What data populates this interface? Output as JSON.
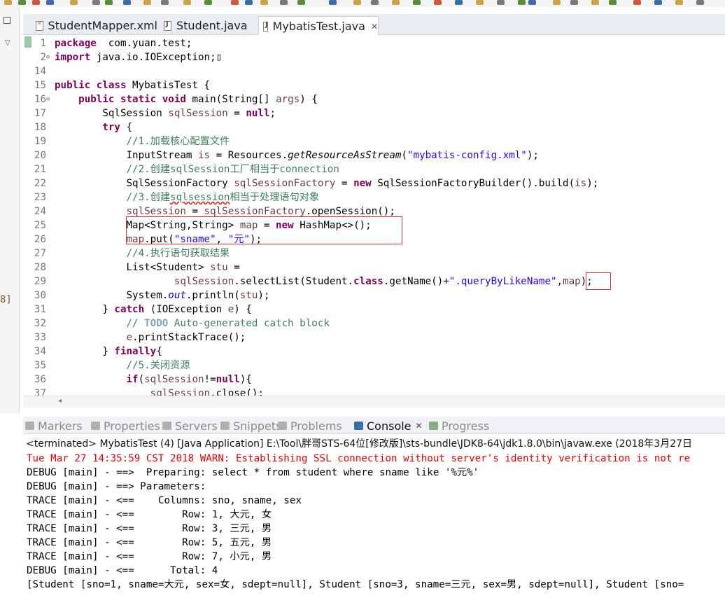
{
  "editor_tabs": [
    {
      "label": "StudentMapper.xml",
      "type": "xml"
    },
    {
      "label": "Student.java",
      "type": "java"
    },
    {
      "label": "MybatisTest.java",
      "type": "java",
      "active": true
    }
  ],
  "left_panel_fragment": "8]",
  "code_lines": [
    {
      "n": "1",
      "tokens": [
        [
          "kw",
          "package"
        ],
        [
          "",
          "  com.yuan.test;"
        ]
      ]
    },
    {
      "n": "2",
      "fold": "⊕",
      "tokens": [
        [
          "kw",
          "import"
        ],
        [
          "",
          " java.io.IOException;"
        ],
        [
          "",
          "▯"
        ]
      ]
    },
    {
      "n": "14",
      "tokens": []
    },
    {
      "n": "15",
      "tokens": [
        [
          "kw",
          "public"
        ],
        [
          "",
          " "
        ],
        [
          "kw",
          "class"
        ],
        [
          "",
          " MybatisTest {"
        ]
      ]
    },
    {
      "n": "16",
      "fold": "⊖",
      "tokens": [
        [
          "",
          "    "
        ],
        [
          "kw",
          "public"
        ],
        [
          "",
          " "
        ],
        [
          "kw",
          "static"
        ],
        [
          "",
          " "
        ],
        [
          "kw",
          "void"
        ],
        [
          "",
          " main(String[] "
        ],
        [
          "lv",
          "args"
        ],
        [
          "",
          ") {"
        ]
      ]
    },
    {
      "n": "17",
      "tokens": [
        [
          "",
          "        SqlSession "
        ],
        [
          "lv",
          "sqlSession"
        ],
        [
          "",
          " = "
        ],
        [
          "kw",
          "null"
        ],
        [
          "",
          ";"
        ]
      ]
    },
    {
      "n": "18",
      "tokens": [
        [
          "",
          "        "
        ],
        [
          "kw",
          "try"
        ],
        [
          "",
          " {"
        ]
      ]
    },
    {
      "n": "19",
      "tokens": [
        [
          "",
          "            "
        ],
        [
          "com",
          "//1.加载核心配置文件"
        ]
      ]
    },
    {
      "n": "20",
      "tokens": [
        [
          "",
          "            InputStream "
        ],
        [
          "lv",
          "is"
        ],
        [
          "",
          " = Resources."
        ],
        [
          "it",
          "getResourceAsStream"
        ],
        [
          "",
          "("
        ],
        [
          "str",
          "\"mybatis-config.xml\""
        ],
        [
          "",
          ");"
        ]
      ]
    },
    {
      "n": "21",
      "tokens": [
        [
          "",
          "            "
        ],
        [
          "com",
          "//2.创建sqlSession工厂相当于connection"
        ]
      ]
    },
    {
      "n": "22",
      "tokens": [
        [
          "",
          "            SqlSessionFactory "
        ],
        [
          "lv",
          "sqlSessionFactory"
        ],
        [
          "",
          " = "
        ],
        [
          "kw",
          "new"
        ],
        [
          "",
          " SqlSessionFactoryBuilder().build("
        ],
        [
          "lv",
          "is"
        ],
        [
          "",
          ");"
        ]
      ]
    },
    {
      "n": "23",
      "tokens": [
        [
          "",
          "            "
        ],
        [
          "com",
          "//3.创建"
        ],
        [
          "comsq",
          "sqlsession"
        ],
        [
          "com",
          "相当于处理语句对象"
        ]
      ]
    },
    {
      "n": "24",
      "tokens": [
        [
          "",
          "            "
        ],
        [
          "lv",
          "sqlSession"
        ],
        [
          "",
          " = "
        ],
        [
          "lv",
          "sqlSessionFactory"
        ],
        [
          "",
          ".openSession();"
        ]
      ]
    },
    {
      "n": "25",
      "tokens": [
        [
          "",
          "            Map<String,String> "
        ],
        [
          "lv",
          "map"
        ],
        [
          "",
          " = "
        ],
        [
          "kw",
          "new"
        ],
        [
          "",
          " HashMap<>();"
        ]
      ]
    },
    {
      "n": "26",
      "tokens": [
        [
          "",
          "            "
        ],
        [
          "lv",
          "map"
        ],
        [
          "",
          ".put("
        ],
        [
          "str",
          "\"sname\""
        ],
        [
          "",
          ", "
        ],
        [
          "str",
          "\"元\""
        ],
        [
          "",
          ");"
        ]
      ]
    },
    {
      "n": "27",
      "tokens": [
        [
          "",
          "            "
        ],
        [
          "com",
          "//4.执行语句获取结果"
        ]
      ]
    },
    {
      "n": "28",
      "tokens": [
        [
          "",
          "            List<Student> "
        ],
        [
          "lv",
          "stu"
        ],
        [
          "",
          " ="
        ]
      ]
    },
    {
      "n": "29",
      "tokens": [
        [
          "",
          "                    "
        ],
        [
          "lv",
          "sqlSession"
        ],
        [
          "",
          ".selectList(Student."
        ],
        [
          "kw",
          "class"
        ],
        [
          "",
          ".getName()+"
        ],
        [
          "str",
          "\".queryByLikeName\""
        ],
        [
          "",
          ","
        ],
        [
          "lv",
          "map"
        ],
        [
          "",
          ");"
        ]
      ]
    },
    {
      "n": "30",
      "tokens": [
        [
          "",
          "            System."
        ],
        [
          "fldit",
          "out"
        ],
        [
          "",
          ".println("
        ],
        [
          "lv",
          "stu"
        ],
        [
          "",
          ");"
        ]
      ]
    },
    {
      "n": "31",
      "tokens": [
        [
          "",
          "        } "
        ],
        [
          "kw",
          "catch"
        ],
        [
          "",
          " (IOException "
        ],
        [
          "lv",
          "e"
        ],
        [
          "",
          ") {"
        ]
      ]
    },
    {
      "n": "32",
      "tokens": [
        [
          "",
          "            "
        ],
        [
          "com",
          "// "
        ],
        [
          "todo",
          "TODO"
        ],
        [
          "com",
          " Auto-generated catch block"
        ]
      ]
    },
    {
      "n": "33",
      "tokens": [
        [
          "",
          "            "
        ],
        [
          "lv",
          "e"
        ],
        [
          "",
          ".printStackTrace();"
        ]
      ]
    },
    {
      "n": "34",
      "tokens": [
        [
          "",
          "        } "
        ],
        [
          "kw",
          "finally"
        ],
        [
          "",
          "{"
        ]
      ]
    },
    {
      "n": "35",
      "tokens": [
        [
          "",
          "            "
        ],
        [
          "com",
          "//5.关闭资源"
        ]
      ]
    },
    {
      "n": "36",
      "tokens": [
        [
          "",
          "            "
        ],
        [
          "kw",
          "if"
        ],
        [
          "",
          "("
        ],
        [
          "lv",
          "sqlSession"
        ],
        [
          "",
          "!="
        ],
        [
          "kw",
          "null"
        ],
        [
          "",
          "){"
        ]
      ]
    },
    {
      "n": "37",
      "tokens": [
        [
          "",
          "                "
        ],
        [
          "lv",
          "sqlSession"
        ],
        [
          "",
          ".close();"
        ]
      ]
    }
  ],
  "view_tabs": [
    {
      "label": "Markers",
      "color": "#b0b0b0"
    },
    {
      "label": "Properties",
      "color": "#b0b0b0"
    },
    {
      "label": "Servers",
      "color": "#b0b0b0"
    },
    {
      "label": "Snippets",
      "color": "#b0b0b0"
    },
    {
      "label": "Problems",
      "color": "#b0b0b0"
    },
    {
      "label": "Console",
      "color": "#3a6ea5",
      "active": true
    },
    {
      "label": "Progress",
      "color": "#7fb07f"
    }
  ],
  "console": {
    "header": "<terminated> MybatisTest (4) [Java Application] E:\\Tool\\胖哥STS-64位[修改版]\\sts-bundle\\JDK8-64\\jdk1.8.0\\bin\\javaw.exe (2018年3月27日",
    "lines": [
      {
        "text": "Tue Mar 27 14:35:59 CST 2018 WARN: Establishing SSL connection without server's identity verification is not re",
        "error": true
      },
      {
        "text": "DEBUG [main] - ==>  Preparing: select * from student where sname like '%元%'"
      },
      {
        "text": "DEBUG [main] - ==> Parameters: "
      },
      {
        "text": "TRACE [main] - <==    Columns: sno, sname, sex"
      },
      {
        "text": "TRACE [main] - <==        Row: 1, 大元, 女"
      },
      {
        "text": "TRACE [main] - <==        Row: 3, 三元, 男"
      },
      {
        "text": "TRACE [main] - <==        Row: 5, 五元, 男"
      },
      {
        "text": "TRACE [main] - <==        Row: 7, 小元, 男"
      },
      {
        "text": "DEBUG [main] - <==      Total: 4"
      },
      {
        "text": "[Student [sno=1, sname=大元, sex=女, sdept=null], Student [sno=3, sname=三元, sex=男, sdept=null], Student [sno="
      }
    ]
  },
  "colors": {
    "keyword": "#7f0055",
    "string": "#2a00ff",
    "comment": "#3f7f5f",
    "local_var": "#6a3e3e",
    "error": "#e60000",
    "highlight_box": "#e03030"
  }
}
